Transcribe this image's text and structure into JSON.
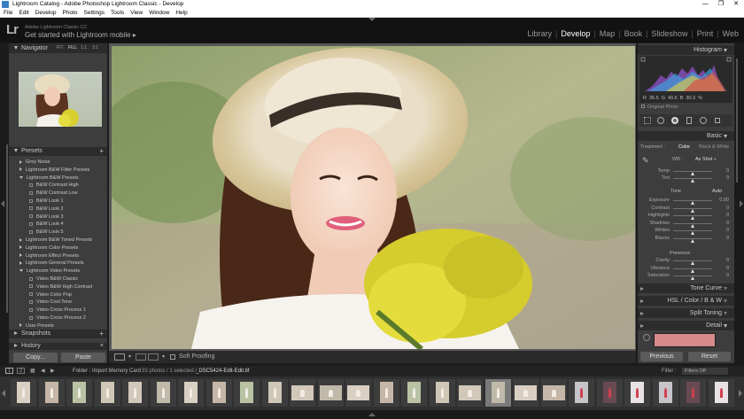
{
  "window": {
    "title": "Lightroom Catalog - Adobe Photoshop Lightroom Classic - Develop",
    "controls": [
      "—",
      "❐",
      "✕"
    ]
  },
  "menu": [
    "File",
    "Edit",
    "Develop",
    "Photo",
    "Settings",
    "Tools",
    "View",
    "Window",
    "Help"
  ],
  "identity": {
    "logo": "Lr",
    "line1": "Adobe Lightroom Classic CC",
    "line2": "Get started with Lightroom mobile",
    "line2_arrow": "▸"
  },
  "modules": [
    {
      "label": "Library",
      "active": false
    },
    {
      "label": "Develop",
      "active": true
    },
    {
      "label": "Map",
      "active": false
    },
    {
      "label": "Book",
      "active": false
    },
    {
      "label": "Slideshow",
      "active": false
    },
    {
      "label": "Print",
      "active": false
    },
    {
      "label": "Web",
      "active": false
    }
  ],
  "left_panel": {
    "navigator": {
      "title": "Navigator",
      "zoom_options": [
        "FIT",
        "FILL",
        "1:1",
        "3:1"
      ]
    },
    "presets": {
      "title": "Presets",
      "add": "+",
      "items": [
        {
          "label": "Grey Noise",
          "type": "folder",
          "level": 0
        },
        {
          "label": "Lightroom B&W Filter Presets",
          "type": "folder",
          "level": 0
        },
        {
          "label": "Lightroom B&W Presets",
          "type": "folder-open",
          "level": 0
        },
        {
          "label": "B&W Contrast High",
          "type": "preset",
          "level": 1
        },
        {
          "label": "B&W Contrast Low",
          "type": "preset",
          "level": 1
        },
        {
          "label": "B&W Look 1",
          "type": "preset",
          "level": 1
        },
        {
          "label": "B&W Look 2",
          "type": "preset",
          "level": 1
        },
        {
          "label": "B&W Look 3",
          "type": "preset",
          "level": 1
        },
        {
          "label": "B&W Look 4",
          "type": "preset",
          "level": 1
        },
        {
          "label": "B&W Look 5",
          "type": "preset",
          "level": 1
        },
        {
          "label": "Lightroom B&W Toned Presets",
          "type": "folder",
          "level": 0
        },
        {
          "label": "Lightroom Color Presets",
          "type": "folder",
          "level": 0
        },
        {
          "label": "Lightroom Effect Presets",
          "type": "folder",
          "level": 0
        },
        {
          "label": "Lightroom General Presets",
          "type": "folder",
          "level": 0
        },
        {
          "label": "Lightroom Video Presets",
          "type": "folder-open",
          "level": 0
        },
        {
          "label": "Video B&W Classic",
          "type": "preset",
          "level": 1
        },
        {
          "label": "Video B&W High Contrast",
          "type": "preset",
          "level": 1
        },
        {
          "label": "Video Color Pop",
          "type": "preset",
          "level": 1
        },
        {
          "label": "Video Cool Tone",
          "type": "preset",
          "level": 1
        },
        {
          "label": "Video Cross Process 1",
          "type": "preset",
          "level": 1
        },
        {
          "label": "Video Cross Process 2",
          "type": "preset",
          "level": 1
        },
        {
          "label": "User Presets",
          "type": "folder",
          "level": 0
        }
      ]
    },
    "snapshots": {
      "title": "Snapshots",
      "add": "+"
    },
    "history": {
      "title": "History",
      "add": "×"
    },
    "copy_button": "Copy...",
    "paste_button": "Paste"
  },
  "toolbar": {
    "soft_proofing": "Soft Proofing"
  },
  "right_panel": {
    "histogram": {
      "title": "Histogram",
      "readout": [
        "R",
        "36.5",
        "G",
        "40.6",
        "B",
        "30.3",
        "%"
      ],
      "original_label": "Original Photo"
    },
    "basic": {
      "title": "Basic",
      "treatment_label": "Treatment :",
      "treatment_options": [
        "Color",
        "Black & White"
      ],
      "wb_label": "WB :",
      "wb_value": "As Shot ÷",
      "tone_label": "Tone",
      "auto_label": "Auto",
      "presence_label": "Presence",
      "sliders_wb": [
        {
          "label": "Temp",
          "value": "0",
          "pos": 0.5
        },
        {
          "label": "Tint",
          "value": "0",
          "pos": 0.5
        }
      ],
      "sliders_tone": [
        {
          "label": "Exposure",
          "value": "0.00",
          "pos": 0.5
        },
        {
          "label": "Contrast",
          "value": "0",
          "pos": 0.5
        },
        {
          "label": "Highlights",
          "value": "0",
          "pos": 0.5
        },
        {
          "label": "Shadows",
          "value": "0",
          "pos": 0.5
        },
        {
          "label": "Whites",
          "value": "0",
          "pos": 0.5
        },
        {
          "label": "Blacks",
          "value": "0",
          "pos": 0.5
        }
      ],
      "sliders_presence": [
        {
          "label": "Clarity",
          "value": "0",
          "pos": 0.5
        },
        {
          "label": "Vibrance",
          "value": "0",
          "pos": 0.5
        },
        {
          "label": "Saturation",
          "value": "0",
          "pos": 0.5
        }
      ]
    },
    "tone_curve": {
      "title": "Tone Curve"
    },
    "hsl": {
      "title": "HSL / Color / B & W"
    },
    "split_toning": {
      "title": "Split Toning"
    },
    "detail": {
      "title": "Detail"
    },
    "previous_button": "Previous",
    "reset_button": "Reset"
  },
  "filmstrip": {
    "page1": "1",
    "page2": "2",
    "source": "Folder : Import Memory Card",
    "count": "33 photos / 1 selected /",
    "filename": "_DSC5424-Edit-Edit.tif",
    "filter_label": "Filter :",
    "filter_value": "Filters Off"
  },
  "colors": {
    "accent": "#ffffff",
    "panel": "#3d3d3d",
    "panel_header": "#2c2c2c",
    "background": "#1b1b1b"
  }
}
